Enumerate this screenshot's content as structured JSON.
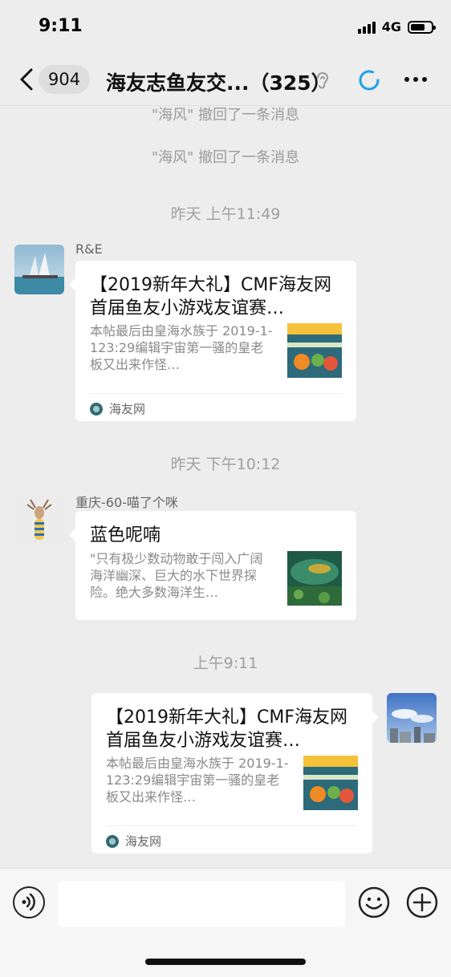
{
  "status": {
    "time": "9:11",
    "network": "4G"
  },
  "nav": {
    "unread_count": "904",
    "title": "海友志鱼友交...（325）"
  },
  "chat": {
    "system_notes": [
      "\"海风\" 撤回了一条消息",
      "\"海风\" 撤回了一条消息"
    ],
    "timestamps": [
      "昨天 上午11:49",
      "昨天 下午10:12",
      "上午9:11"
    ],
    "messages": [
      {
        "sender": "R&E",
        "title": "【2019新年大礼】CMF海友网首届鱼友小游戏友谊赛…",
        "description": "本帖最后由皇海水族于 2019-1-123:29编辑宇宙第一骚的皇老板又出来作怪…",
        "source": "海友网"
      },
      {
        "sender": "重庆-60-喵了个咪",
        "title": "蓝色呢喃",
        "description": "\"只有极少数动物敢于闯入广阔海洋幽深、巨大的水下世界探险。绝大多数海洋生…"
      },
      {
        "sender": "",
        "title": "【2019新年大礼】CMF海友网首届鱼友小游戏友谊赛…",
        "description": "本帖最后由皇海水族于 2019-1-123:29编辑宇宙第一骚的皇老板又出来作怪…",
        "source": "海友网"
      }
    ]
  },
  "input": {
    "placeholder": ""
  },
  "colors": {
    "background": "#ededed",
    "bubble": "#ffffff",
    "loading_accent": "#1aa0e8",
    "meta_text": "#9b9b9b"
  }
}
